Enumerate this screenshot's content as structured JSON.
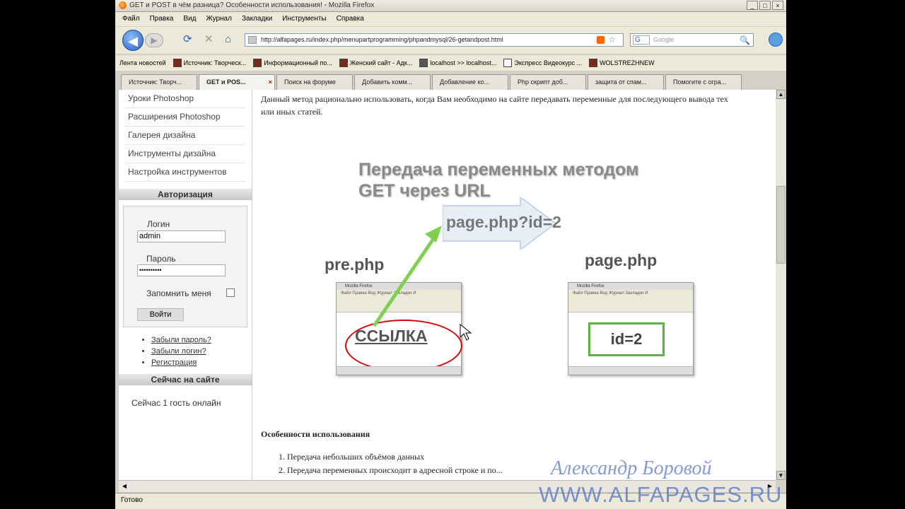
{
  "window": {
    "title": "GET и POST в чём разница? Особенности использования! - Mozilla Firefox",
    "controls": [
      "_",
      "□",
      "×"
    ]
  },
  "menubar": [
    "Файл",
    "Правка",
    "Вид",
    "Журнал",
    "Закладки",
    "Инструменты",
    "Справка"
  ],
  "navbar": {
    "url": "http://alfapages.ru/index.php/menupartprogramming/phpandmysql/26-getandpost.html",
    "search_placeholder": "Google",
    "search_engine": "G"
  },
  "bookmarks": [
    "Лента новостей",
    "Источник: Творческ...",
    "Информационный по...",
    "Женский сайт - Адк...",
    "localhost >> localhost...",
    "Экспресс Видеокурс ...",
    "WOLSTREZHNEW"
  ],
  "tabs": [
    "Источник: Творч...",
    "GET и POS...",
    "Поиск на форуме",
    "Добавить комм...",
    "Добавление ко...",
    "Php скрипт доб...",
    "защита от спам...",
    "Помогите с огра..."
  ],
  "sidebar": {
    "items": [
      "Уроки Photoshop",
      "Расширения Photoshop",
      "Галерея дизайна",
      "Инструменты дизайна",
      "Настройка инструментов"
    ],
    "auth_header": "Авторизация",
    "login_label": "Логин",
    "login_value": "admin",
    "password_label": "Пароль",
    "password_value": "••••••••••",
    "remember_label": "Запомнить меня",
    "login_button": "Войти",
    "links": [
      "Забыли пароль?",
      "Забыли логин?",
      "Регистрация"
    ],
    "online_header": "Сейчас на сайте",
    "online_text": "Сейчас 1 гость онлайн"
  },
  "article": {
    "intro": "Данный метод рационально использовать, когда Вам необходимо на сайте передавать переменные для последующего вывода тех или иных статей.",
    "diagram": {
      "title_line1": "Передача переменных методом",
      "title_line2": "GET через URL",
      "url_label": "page.php?id=2",
      "left_label": "pre.php",
      "right_label": "page.php",
      "link_text": "ССЫЛКА",
      "id_text": "id=2",
      "mini_title": "Mozilla Firefox",
      "mini_menu": "Файл Правка Вид Журнал Закладки И"
    },
    "section_title": "Особенности использования",
    "list": [
      "Передача небольших объёмов данных",
      "Передача переменных происходит в адресной строке и по..."
    ]
  },
  "statusbar": "Готово",
  "watermark": {
    "signature": "Александр Боровой",
    "site": "WWW.ALFAPAGES.RU"
  }
}
